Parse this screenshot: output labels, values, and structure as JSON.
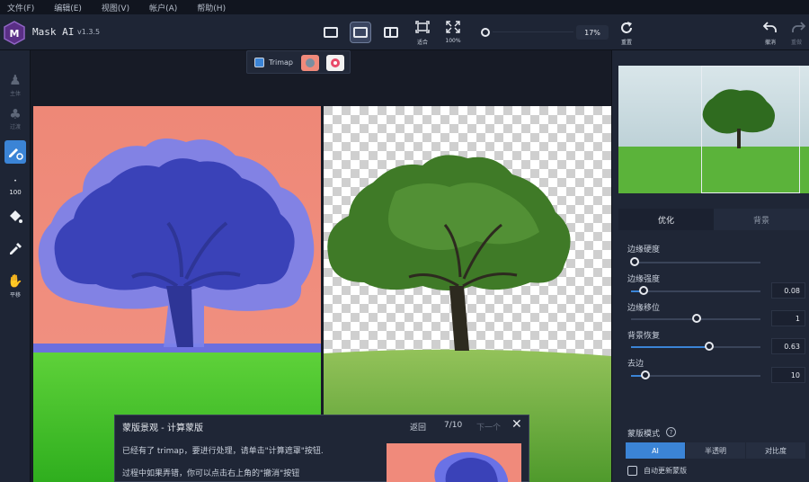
{
  "menu": [
    "文件(F)",
    "编辑(E)",
    "视图(V)",
    "帐户(A)",
    "帮助(H)"
  ],
  "app": {
    "title": "Mask AI",
    "version": "v1.3.5"
  },
  "toolbar": {
    "fit_label": "适合",
    "full_label": "100%",
    "zoom_value": "17%",
    "reset_label": "重置",
    "undo_label": "撤消",
    "redo_label": "重做"
  },
  "left_tools": {
    "subject_label": "主体",
    "transition_label": "过渡",
    "brush_size": "100",
    "pan_label": "平移"
  },
  "trimap": {
    "label": "Trimap"
  },
  "guide": {
    "title": "蒙版景观 - 计算蒙版",
    "back": "返回",
    "page": "7/10",
    "next": "下一个",
    "close": "✕",
    "line1": "已经有了 trimap，要进行处理，请单击\"计算遮罩\"按钮.",
    "line2": "过程中如果弄错，你可以点击右上角的\"撤消\"按钮"
  },
  "right_panel": {
    "tabs": [
      "优化",
      "背景"
    ],
    "sliders": [
      {
        "label": "边缘硬度",
        "value": "",
        "fraction": 0.0
      },
      {
        "label": "边缘强度",
        "value": "0.08",
        "fraction": 0.08
      },
      {
        "label": "边缘移位",
        "value": "1",
        "fraction": 0.5
      },
      {
        "label": "背景恢复",
        "value": "0.63",
        "fraction": 0.63
      },
      {
        "label": "去边",
        "value": "10",
        "fraction": 0.1
      }
    ],
    "mode_title": "蒙版模式",
    "help": "?",
    "modes": [
      "AI",
      "半透明",
      "对比度"
    ],
    "auto_update": "自动更新蒙版"
  },
  "colors": {
    "accent": "#3b84d6",
    "background_fill": "#f08a7b",
    "mask_overlay": "#6a72e6",
    "panel": "#1f2636"
  }
}
